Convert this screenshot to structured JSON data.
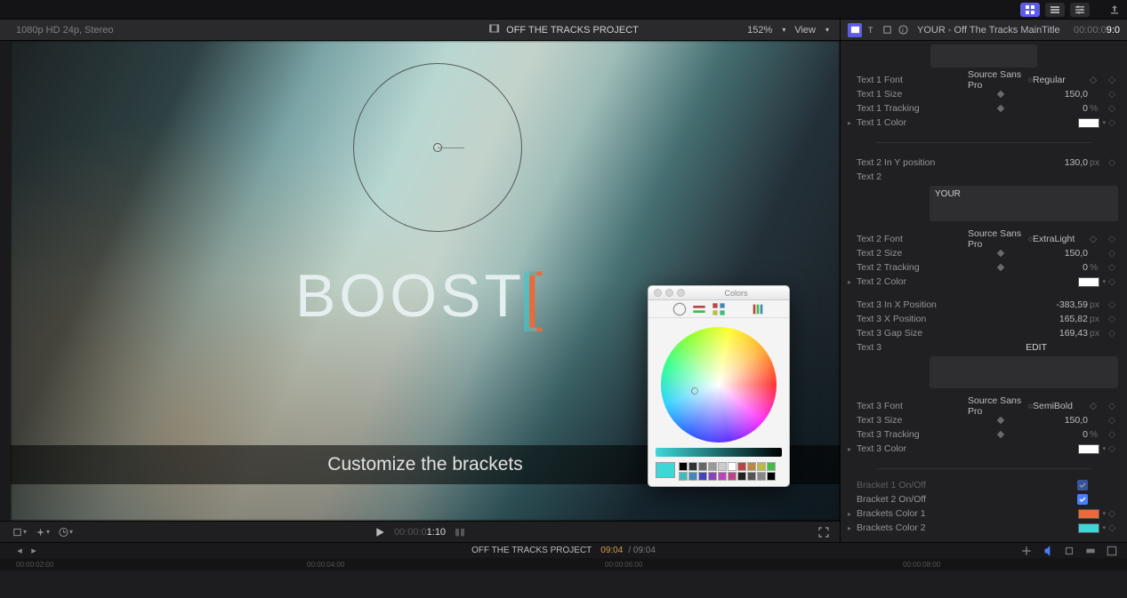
{
  "topstrip": {
    "layout_buttons": [
      "grid",
      "list",
      "settings"
    ]
  },
  "header": {
    "format": "1080p HD 24p, Stereo",
    "project_title": "OFF THE TRACKS PROJECT",
    "zoom": "152%",
    "view_label": "View",
    "clip_title": "YOUR - Off The Tracks MainTitle",
    "right_tc_dim": "00:00:0",
    "right_tc_bright": "9:0"
  },
  "viewer": {
    "boost_text": "BOOST",
    "caption": "Customize the brackets"
  },
  "color_picker": {
    "title": "Colors"
  },
  "transport": {
    "tc_prefix": "00:00:0",
    "tc_main": "1:10"
  },
  "inspector": {
    "text1": {
      "font_label": "Text 1 Font",
      "font_value": "Source Sans Pro",
      "style_value": "Regular",
      "size_label": "Text 1 Size",
      "size_value": "150,0",
      "tracking_label": "Text 1 Tracking",
      "tracking_value": "0",
      "tracking_unit": "%",
      "color_label": "Text 1 Color"
    },
    "text2": {
      "ypos_label": "Text 2 In Y position",
      "ypos_value": "130,0",
      "ypos_unit": "px",
      "text_label": "Text 2",
      "text_value": "YOUR",
      "font_label": "Text 2 Font",
      "font_value": "Source Sans Pro",
      "style_value": "ExtraLight",
      "size_label": "Text 2 Size",
      "size_value": "150,0",
      "tracking_label": "Text 2 Tracking",
      "tracking_value": "0",
      "tracking_unit": "%",
      "color_label": "Text 2 Color"
    },
    "text3": {
      "inxpos_label": "Text 3 In X Position",
      "inxpos_value": "-383,59",
      "px": "px",
      "xpos_label": "Text 3 X Position",
      "xpos_value": "165,82",
      "gap_label": "Text 3 Gap Size",
      "gap_value": "169,43",
      "text_label": "Text 3",
      "text_value": "EDIT",
      "font_label": "Text 3 Font",
      "font_value": "Source Sans Pro",
      "style_value": "SemiBold",
      "size_label": "Text 3 Size",
      "size_value": "150,0",
      "tracking_label": "Text 3 Tracking",
      "tracking_value": "0",
      "tracking_unit": "%",
      "color_label": "Text 3 Color"
    },
    "brackets": {
      "b1_label": "Bracket 1 On/Off",
      "b2_label": "Bracket 2 On/Off",
      "c1_label": "Brackets Color 1",
      "c1_value": "#e96a3a",
      "c2_label": "Brackets Color 2",
      "c2_value": "#3fd6d8"
    }
  },
  "timeline_info": {
    "project": "OFF THE TRACKS PROJECT",
    "current": "09:04",
    "duration": "/ 09:04"
  },
  "ruler": {
    "t1": "00:00:02:00",
    "t2": "00:00:04:00",
    "t3": "00:00:06:00",
    "t4": "00:00:08:00"
  }
}
